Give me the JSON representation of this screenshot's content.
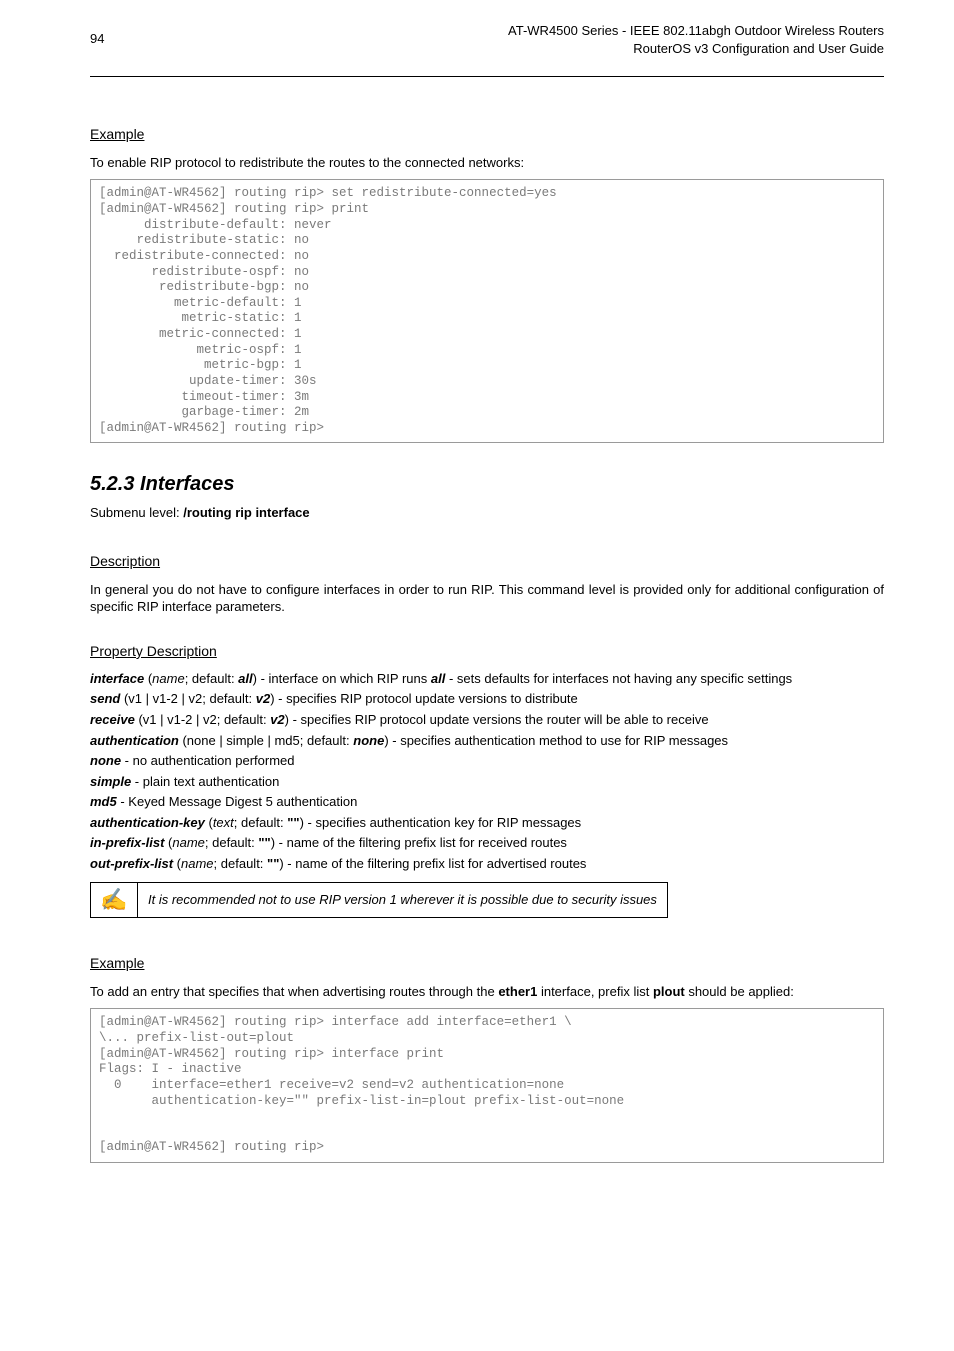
{
  "header": {
    "page_number": "94",
    "title_line1": "AT-WR4500 Series - IEEE 802.11abgh Outdoor Wireless Routers",
    "title_line2": "RouterOS v3 Configuration and User Guide"
  },
  "example1": {
    "heading": "Example",
    "intro": "To enable RIP protocol to redistribute the routes to the connected networks:",
    "code": "[admin@AT-WR4562] routing rip> set redistribute-connected=yes\n[admin@AT-WR4562] routing rip> print\n      distribute-default: never\n     redistribute-static: no\n  redistribute-connected: no\n       redistribute-ospf: no\n        redistribute-bgp: no\n          metric-default: 1\n           metric-static: 1\n        metric-connected: 1\n             metric-ospf: 1\n              metric-bgp: 1\n            update-timer: 30s\n           timeout-timer: 3m\n           garbage-timer: 2m\n[admin@AT-WR4562] routing rip>"
  },
  "section": {
    "number_title": "5.2.3  Interfaces",
    "submenu_label": "Submenu level: ",
    "submenu_value": "/routing rip interface"
  },
  "description": {
    "heading": "Description",
    "text": "In general you do not have to configure interfaces in order to run RIP. This command level is provided only for additional configuration of specific RIP interface parameters."
  },
  "propdesc": {
    "heading": "Property Description",
    "interface_a": "interface",
    "interface_mid": " (",
    "interface_name": "name",
    "interface_b": "; default: ",
    "interface_def": "all",
    "interface_c": ") - interface on which RIP runs ",
    "interface_all2": "all",
    "interface_d": " - sets defaults for interfaces not having any specific settings",
    "send_a": "send",
    "send_mid": " (v1 | v1-2 | v2; default: ",
    "send_def": "v2",
    "send_b": ") - specifies RIP protocol update versions to distribute",
    "receive_a": "receive",
    "receive_mid": " (v1 | v1-2 | v2; default: ",
    "receive_def": "v2",
    "receive_b": ") - specifies RIP protocol update versions the router will be able to receive",
    "auth_a": "authentication",
    "auth_mid": " (none | simple | md5; default: ",
    "auth_def": "none",
    "auth_b": ") - specifies authentication method to use for RIP messages",
    "none_a": "none",
    "none_b": " - no authentication performed",
    "simple_a": "simple",
    "simple_b": " - plain text authentication",
    "md5_a": "md5",
    "md5_b": " - Keyed Message Digest 5 authentication",
    "authkey_a": "authentication-key",
    "authkey_mid": " (",
    "authkey_text": "text",
    "authkey_b": "; default: ",
    "authkey_def": "\"\"",
    "authkey_c": ") - specifies authentication key for RIP messages",
    "inpre_a": "in-prefix-list",
    "inpre_mid": " (",
    "inpre_name": "name",
    "inpre_b": "; default: ",
    "inpre_def": "\"\"",
    "inpre_c": ") - name of the filtering prefix list for received routes",
    "outpre_a": "out-prefix-list",
    "outpre_mid": " (",
    "outpre_name": "name",
    "outpre_b": "; default: ",
    "outpre_def": "\"\"",
    "outpre_c": ") - name of the filtering prefix list for advertised routes"
  },
  "note": {
    "icon": "✍",
    "text": "It is recommended not to use RIP version 1 wherever it is possible due to security issues"
  },
  "example2": {
    "heading": "Example",
    "intro_a": "To add an entry that specifies that when advertising routes through the ",
    "intro_eth": "ether1",
    "intro_b": " interface, prefix list ",
    "intro_plout": "plout",
    "intro_c": " should be applied:",
    "code": "[admin@AT-WR4562] routing rip> interface add interface=ether1 \\\n\\... prefix-list-out=plout\n[admin@AT-WR4562] routing rip> interface print\nFlags: I - inactive\n  0    interface=ether1 receive=v2 send=v2 authentication=none\n       authentication-key=\"\" prefix-list-in=plout prefix-list-out=none\n\n\n[admin@AT-WR4562] routing rip>"
  }
}
